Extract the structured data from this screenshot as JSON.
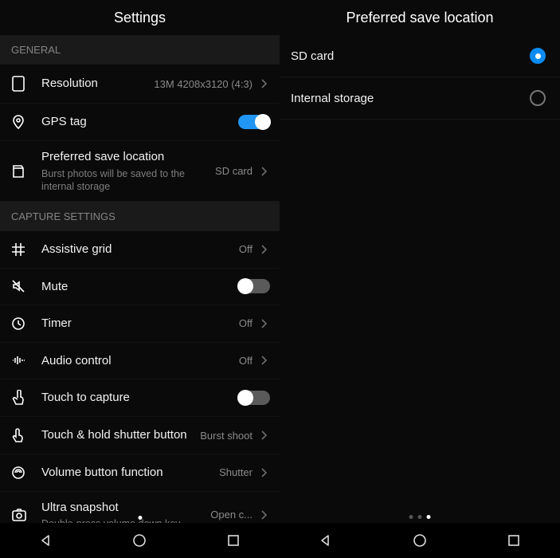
{
  "left": {
    "title": "Settings",
    "sections": {
      "general": "GENERAL",
      "capture": "CAPTURE SETTINGS"
    },
    "rows": {
      "resolution": {
        "label": "Resolution",
        "value": "13M 4208x3120 (4:3)"
      },
      "gps": {
        "label": "GPS tag"
      },
      "save_loc": {
        "label": "Preferred save location",
        "sub": "Burst photos will be saved to the internal storage",
        "value": "SD card"
      },
      "grid": {
        "label": "Assistive grid",
        "value": "Off"
      },
      "mute": {
        "label": "Mute"
      },
      "timer": {
        "label": "Timer",
        "value": "Off"
      },
      "audio": {
        "label": "Audio control",
        "value": "Off"
      },
      "touch": {
        "label": "Touch to capture"
      },
      "hold": {
        "label": "Touch & hold shutter button",
        "value": "Burst shoot"
      },
      "volbtn": {
        "label": "Volume button function",
        "value": "Shutter"
      },
      "ultra": {
        "label": "Ultra snapshot",
        "sub": "Double-press volume down key",
        "value": "Open c..."
      }
    }
  },
  "right": {
    "title": "Preferred save location",
    "options": {
      "sd": "SD card",
      "internal": "Internal storage"
    }
  }
}
